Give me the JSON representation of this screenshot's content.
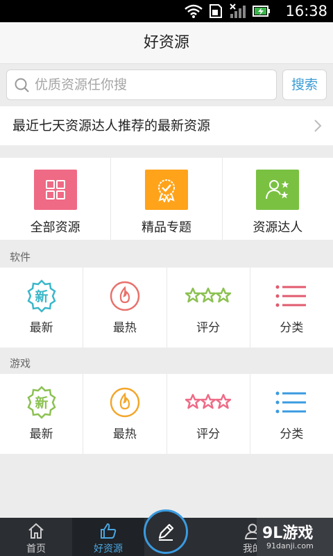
{
  "status": {
    "time": "16:38"
  },
  "header": {
    "title": "好资源"
  },
  "search": {
    "placeholder": "优质资源任你搜",
    "button": "搜索"
  },
  "recommend": {
    "text": "最近七天资源达人推荐的最新资源"
  },
  "categories": [
    {
      "label": "全部资源",
      "color": "#ef6a85",
      "icon": "grid-icon"
    },
    {
      "label": "精品专题",
      "color": "#ffa31a",
      "icon": "badge-check-icon"
    },
    {
      "label": "资源达人",
      "color": "#7ac142",
      "icon": "user-star-icon"
    }
  ],
  "software": {
    "title": "软件",
    "items": [
      {
        "label": "最新",
        "icon": "new-badge-icon",
        "color": "#3ab7c9"
      },
      {
        "label": "最热",
        "icon": "fire-icon",
        "color": "#e8716b"
      },
      {
        "label": "评分",
        "icon": "stars-icon",
        "color": "#8cc152"
      },
      {
        "label": "分类",
        "icon": "list-icon",
        "color": "#e15a6e"
      }
    ]
  },
  "games": {
    "title": "游戏",
    "items": [
      {
        "label": "最新",
        "icon": "new-badge-icon",
        "color": "#8cc152"
      },
      {
        "label": "最热",
        "icon": "fire-icon",
        "color": "#f3a62a"
      },
      {
        "label": "评分",
        "icon": "stars-icon",
        "color": "#ee6b86"
      },
      {
        "label": "分类",
        "icon": "list-icon",
        "color": "#3a9be0"
      }
    ]
  },
  "nav": {
    "items": [
      {
        "label": "首页",
        "icon": "home-icon"
      },
      {
        "label": "好资源",
        "icon": "thumbs-up-icon"
      },
      {
        "label": "我的",
        "icon": "person-icon"
      }
    ],
    "fab_icon": "pencil-icon"
  },
  "watermark": {
    "brand": "9L游戏",
    "url": "91danji.com"
  }
}
